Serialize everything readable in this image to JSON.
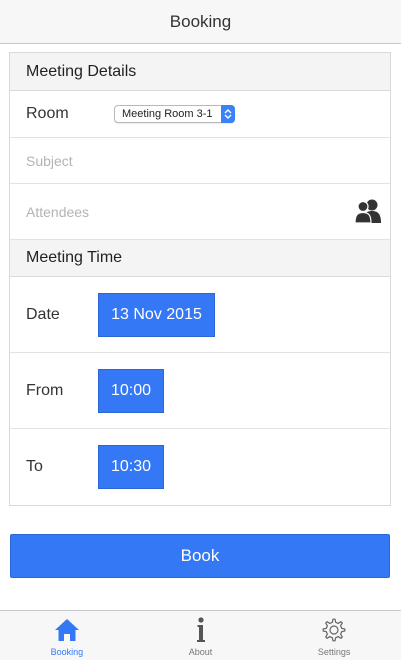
{
  "header": {
    "title": "Booking"
  },
  "meeting_details": {
    "heading": "Meeting Details",
    "room_label": "Room",
    "room_selected": "Meeting Room 3-1",
    "subject_placeholder": "Subject",
    "attendees_placeholder": "Attendees",
    "attendees_icon": "people-icon"
  },
  "meeting_time": {
    "heading": "Meeting Time",
    "date_label": "Date",
    "date_value": "13 Nov 2015",
    "from_label": "From",
    "from_value": "10:00",
    "to_label": "To",
    "to_value": "10:30"
  },
  "actions": {
    "book_label": "Book"
  },
  "tabbar": {
    "items": [
      {
        "label": "Booking",
        "icon": "home-icon",
        "active": true
      },
      {
        "label": "About",
        "icon": "info-icon",
        "active": false
      },
      {
        "label": "Settings",
        "icon": "gear-icon",
        "active": false
      }
    ]
  },
  "colors": {
    "accent": "#3478f6",
    "header_bg": "#f7f7f7",
    "section_bg": "#f4f4f4"
  }
}
